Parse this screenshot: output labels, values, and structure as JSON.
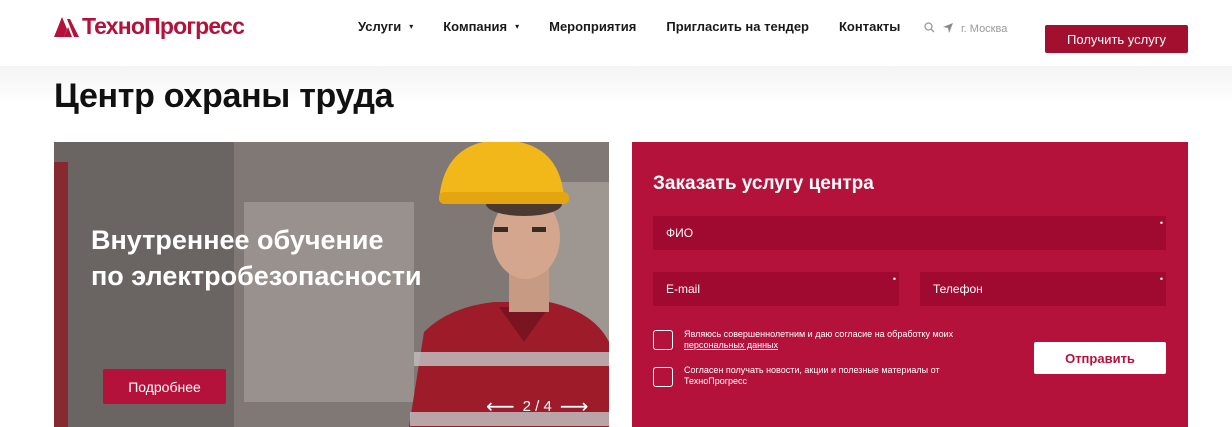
{
  "header": {
    "logo_text": "ТехноПрогресс",
    "nav": [
      {
        "label": "Услуги",
        "dropdown": true
      },
      {
        "label": "Компания",
        "dropdown": true
      },
      {
        "label": "Мероприятия",
        "dropdown": false
      },
      {
        "label": "Пригласить на тендер",
        "dropdown": false
      },
      {
        "label": "Контакты",
        "dropdown": false
      }
    ],
    "city": "г. Москва",
    "cta_label": "Получить услугу"
  },
  "page": {
    "title": "Центр охраны труда"
  },
  "banner": {
    "title_line1": "Внутреннее обучение",
    "title_line2": "по электробезопасности",
    "button_label": "Подробнее",
    "slider": {
      "prev": "⟵",
      "counter": "2 / 4",
      "next": "⟶"
    }
  },
  "form": {
    "title": "Заказать услугу центра",
    "fields": {
      "fio": "ФИО",
      "email": "E-mail",
      "phone": "Телефон"
    },
    "required_mark": "•",
    "consent1_text": "Являюсь совершеннолетним и даю согласие на обработку моих",
    "consent1_link": "персональных данных",
    "consent2_text": "Согласен получать новости, акции и полезные материалы от ТехноПрогресс",
    "submit_label": "Отправить"
  },
  "colors": {
    "brand": "#b5123b",
    "brand_dark": "#a10a30",
    "text": "#1a1a1a"
  },
  "icons": [
    "logo-mark-icon",
    "chevron-down-icon",
    "search-icon",
    "location-arrow-icon",
    "arrow-left-icon",
    "arrow-right-icon"
  ]
}
